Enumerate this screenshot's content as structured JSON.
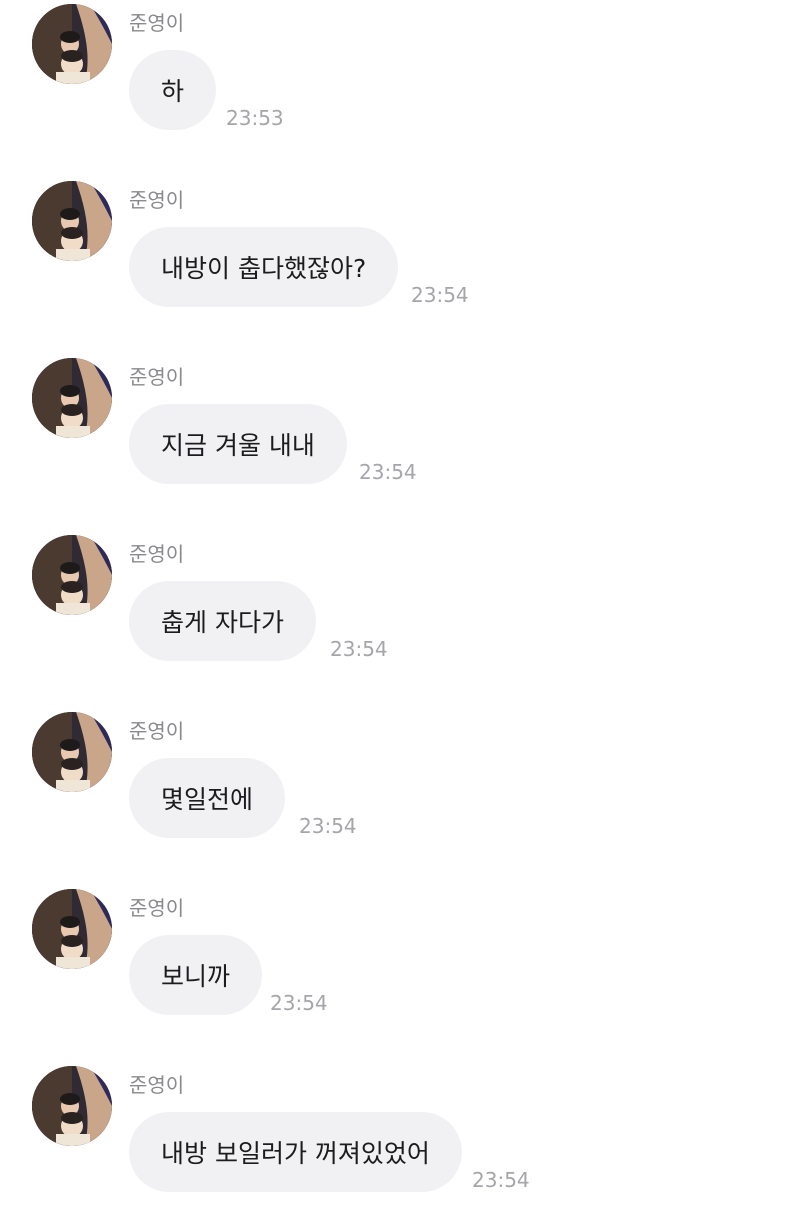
{
  "chat": {
    "messages": [
      {
        "sender": "준영이",
        "text": "하",
        "time": "23:53",
        "avatar": "profile-photo"
      },
      {
        "sender": "준영이",
        "text": "내방이 춥다했잖아?",
        "time": "23:54",
        "avatar": "profile-photo"
      },
      {
        "sender": "준영이",
        "text": "지금 겨울 내내",
        "time": "23:54",
        "avatar": "profile-photo"
      },
      {
        "sender": "준영이",
        "text": "춥게 자다가",
        "time": "23:54",
        "avatar": "profile-photo"
      },
      {
        "sender": "준영이",
        "text": "몇일전에",
        "time": "23:54",
        "avatar": "profile-photo"
      },
      {
        "sender": "준영이",
        "text": "보니까",
        "time": "23:54",
        "avatar": "profile-photo"
      },
      {
        "sender": "준영이",
        "text": "내방 보일러가 꺼져있었어",
        "time": "23:54",
        "avatar": "profile-photo"
      }
    ]
  }
}
